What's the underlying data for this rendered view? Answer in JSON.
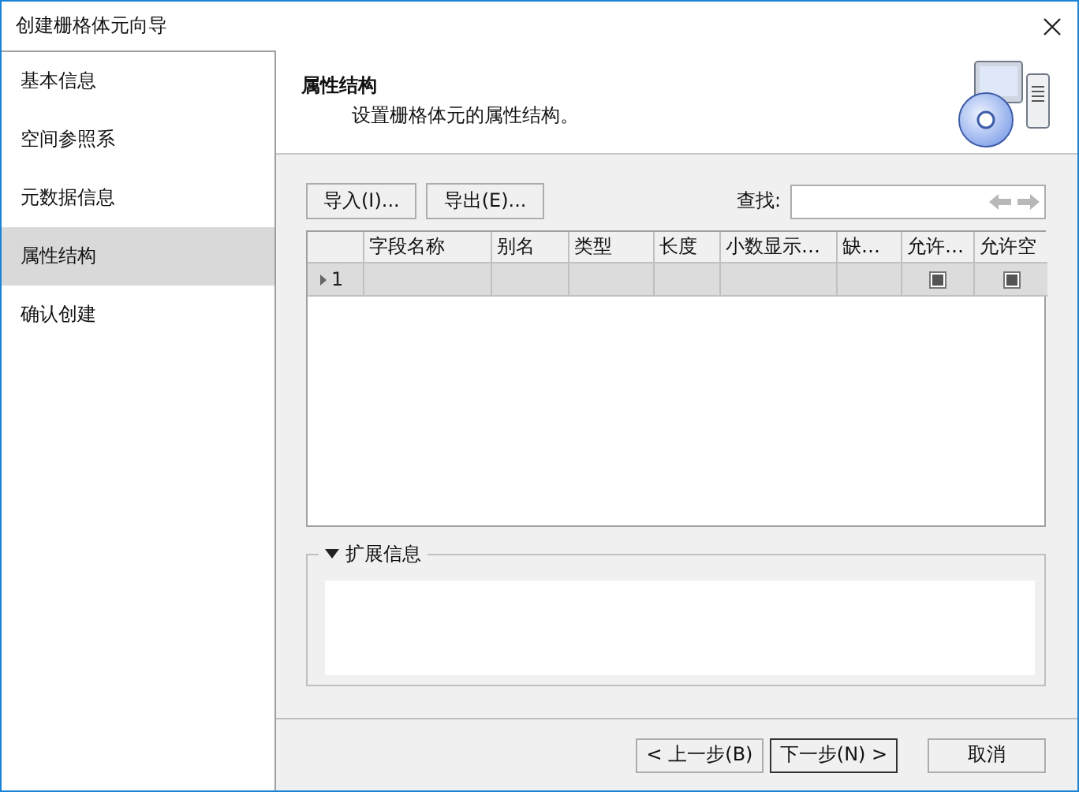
{
  "window": {
    "title": "创建栅格体元向导"
  },
  "sidebar": {
    "items": [
      {
        "label": "基本信息",
        "selected": false
      },
      {
        "label": "空间参照系",
        "selected": false
      },
      {
        "label": "元数据信息",
        "selected": false
      },
      {
        "label": "属性结构",
        "selected": true
      },
      {
        "label": "确认创建",
        "selected": false
      }
    ]
  },
  "header": {
    "title": "属性结构",
    "subtitle": "设置栅格体元的属性结构。"
  },
  "toolbar": {
    "buttons": [
      "导入(I)...",
      "导出(E)..."
    ],
    "search_label": "查找:"
  },
  "table": {
    "columns": [
      {
        "label": "字段名称",
        "kind": "text"
      },
      {
        "label": "别名",
        "kind": "text"
      },
      {
        "label": "类型",
        "kind": "text"
      },
      {
        "label": "长度",
        "kind": "text"
      },
      {
        "label": "小数显示…",
        "kind": "text"
      },
      {
        "label": "缺…",
        "kind": "text"
      },
      {
        "label": "允许…",
        "kind": "checkbox"
      },
      {
        "label": "允许空",
        "kind": "checkbox"
      }
    ],
    "rows": [
      {
        "number": "1",
        "current": true,
        "checks": [
          {
            "checked": true
          },
          {
            "checked": true
          }
        ]
      }
    ]
  },
  "extension": {
    "title": "扩展信息",
    "expanded": true
  },
  "footer": {
    "buttons": [
      {
        "label": "< 上一步(B)",
        "default": false
      },
      {
        "label": "下一步(N) >",
        "default": true
      },
      {
        "label": "取消",
        "default": false
      }
    ]
  }
}
